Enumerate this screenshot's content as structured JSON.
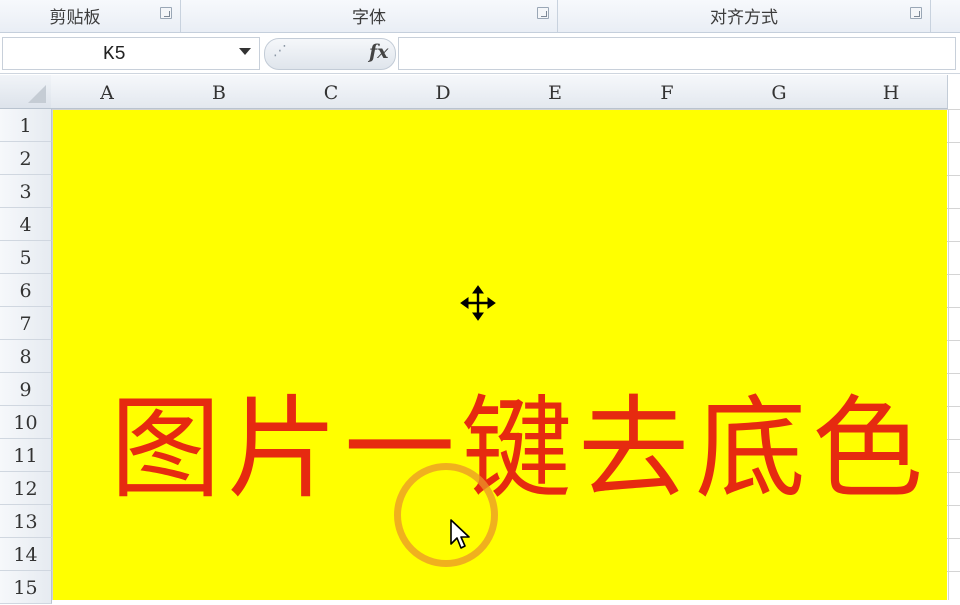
{
  "ribbon": {
    "groups": [
      {
        "label": "剪贴板"
      },
      {
        "label": "字体"
      },
      {
        "label": "对齐方式"
      }
    ]
  },
  "formula_bar": {
    "name_box": "K5",
    "fx_label": "fx",
    "formula": ""
  },
  "grid": {
    "columns": [
      "A",
      "B",
      "C",
      "D",
      "E",
      "F",
      "G",
      "H"
    ],
    "rows": [
      "1",
      "2",
      "3",
      "4",
      "5",
      "6",
      "7",
      "8",
      "9",
      "10",
      "11",
      "12",
      "13",
      "14",
      "15"
    ]
  },
  "picture": {
    "text": "图片一键去底色",
    "background_color": "#ffff00",
    "text_color": "#e62a10"
  },
  "icons": {
    "dialog_launcher": "dialog-launcher-icon",
    "move_cursor": "move-cursor-icon",
    "arrow_cursor": "arrow-cursor-icon",
    "fx": "fx-icon"
  }
}
